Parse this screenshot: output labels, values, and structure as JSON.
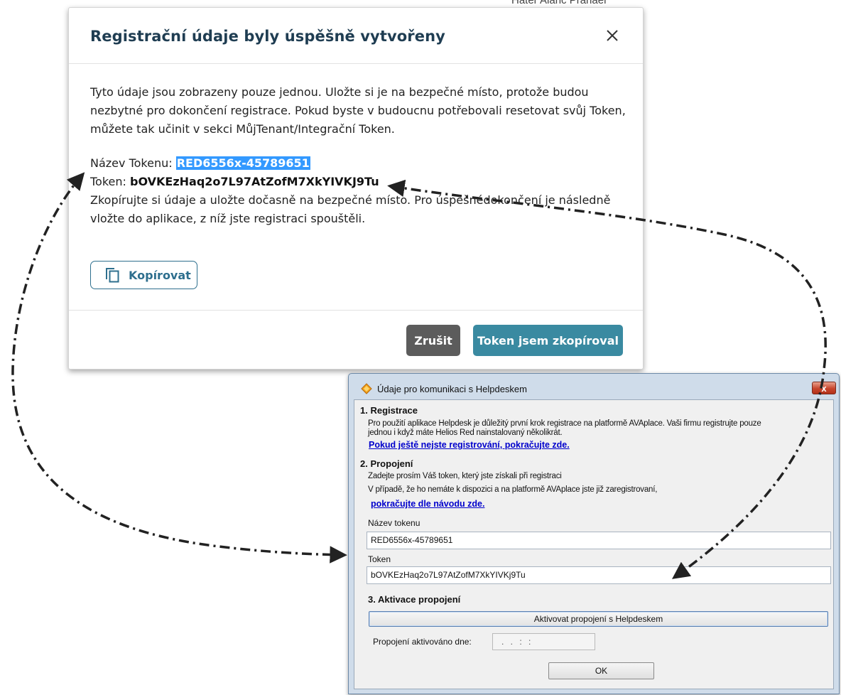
{
  "background": {
    "fragment": "Hater Alaric Pranaer"
  },
  "web_modal": {
    "title": "Registrační údaje byly úspěšně vytvořeny",
    "close_icon": "close-icon",
    "intro": "Tyto údaje jsou zobrazeny pouze jednou. Uložte si je na bezpečné místo, protože budou nezbytné pro dokončení registrace. Pokud byste v budoucnu potřebovali resetovat svůj Token, můžete tak učinit v sekci MůjTenant/Integrační Token.",
    "token_name_label": "Název Tokenu: ",
    "token_name_value": "RED6556x-45789651",
    "token_label": "Token: ",
    "token_value": "bOVKEzHaq2o7L97AtZofM7XkYIVKJ9Tu",
    "copy_note": "Zkopírujte si údaje a uložte dočasně na bezpečné místo. Pro úspěšnédokončení je následně vložte do aplikace, z níž jste registraci spouštěli.",
    "copy_button": "Kopírovat",
    "cancel_button": "Zrušit",
    "confirm_button": "Token jsem zkopíroval",
    "colors": {
      "title": "#1f3d52",
      "accent": "#3a8aa1",
      "cancel": "#5c5c5c",
      "selection": "#3399ff"
    }
  },
  "win_dialog": {
    "title": "Údaje pro komunikaci s Helpdeskem",
    "close_label": "x",
    "section1": {
      "heading": "1. Registrace",
      "text_line1": "Pro použití aplikace Helpdesk je důležitý první krok registrace na platformě AVAplace. Vaši firmu registrujte pouze",
      "text_line2": "jednou i když máte Helios Red nainstalovaný několikrát.",
      "link": "Pokud ještě nejste registrování, pokračujte zde."
    },
    "section2": {
      "heading": "2. Propojení",
      "text_line1": "Zadejte prosím Váš token, který jste získali při registraci",
      "text_line2": "V případě, že ho nemáte k dispozici a na platformě AVAplace jste již zaregistrovaní,",
      "link": "pokračujte dle návodu zde."
    },
    "token_name_label": "Název tokenu",
    "token_name_value": "RED6556x-45789651",
    "token_label": "Token",
    "token_value": "bOVKEzHaq2o7L97AtZofM7XkYIVKj9Tu",
    "section3": {
      "heading": "3. Aktivace propojení",
      "activate_button": "Aktivovat propojení s Helpdeskem",
      "activated_label": "Propojení aktivováno dne:",
      "activated_value": ". .    : :"
    },
    "ok_button": "OK"
  }
}
